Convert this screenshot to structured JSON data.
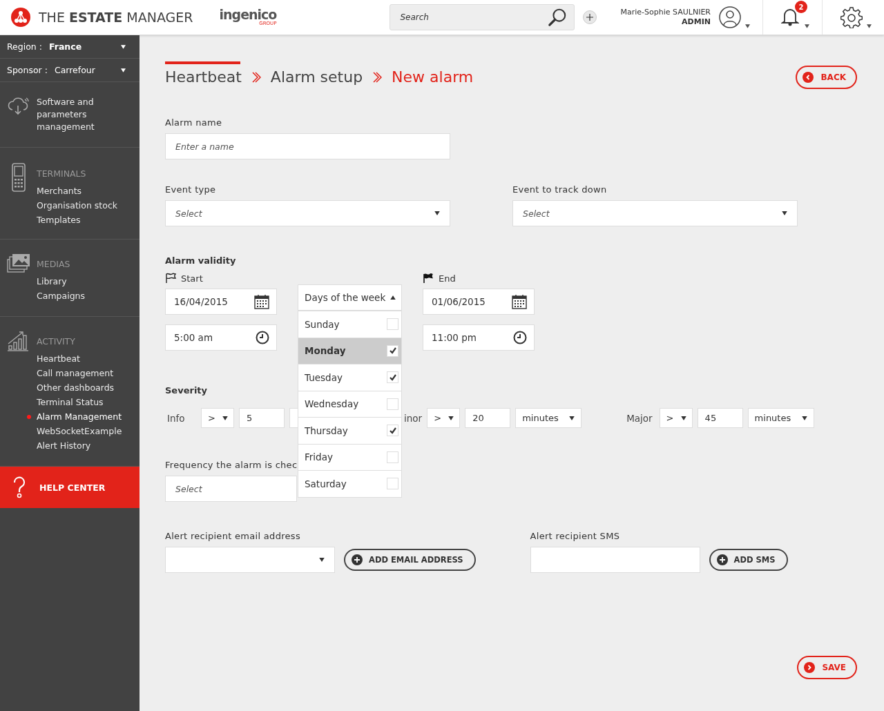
{
  "header": {
    "app_title": "THE **ESTATE** MANAGER",
    "brand": "ingenico",
    "brand_sub": "GROUP",
    "search": {
      "placeholder": "Search"
    },
    "user": {
      "name": "Marie-Sophie SAULNIER",
      "role": "ADMIN"
    },
    "notifications": "2"
  },
  "sidebar": {
    "filters": [
      {
        "label": "Region :",
        "value": "France",
        "bold": true
      },
      {
        "label": "Sponsor :",
        "value": "Carrefour",
        "bold": false
      }
    ],
    "sections": [
      {
        "kind": "cloud",
        "items": [
          {
            "label": "Software and parameters management",
            "active": false
          }
        ]
      },
      {
        "kind": "terminal",
        "heading": "TERMINALS",
        "items": [
          {
            "label": "Merchants",
            "active": false
          },
          {
            "label": "Organisation stock",
            "active": false
          },
          {
            "label": "Templates",
            "active": false
          }
        ]
      },
      {
        "kind": "media",
        "heading": "MEDIAS",
        "items": [
          {
            "label": "Library",
            "active": false
          },
          {
            "label": "Campaigns",
            "active": false
          }
        ]
      },
      {
        "kind": "activity",
        "heading": "ACTIVITY",
        "items": [
          {
            "label": "Heartbeat",
            "active": false
          },
          {
            "label": "Call management",
            "active": false
          },
          {
            "label": "Other dashboards",
            "active": false
          },
          {
            "label": "Terminal Status",
            "active": false
          },
          {
            "label": "Alarm Management",
            "active": true
          },
          {
            "label": "WebSocketExample",
            "active": false
          },
          {
            "label": "Alert History",
            "active": false
          }
        ]
      }
    ],
    "help": "HELP CENTER"
  },
  "breadcrumb": [
    {
      "label": "Heartbeat",
      "current": false
    },
    {
      "label": "Alarm setup",
      "current": false
    },
    {
      "label": "New alarm",
      "current": true
    }
  ],
  "back_button": "BACK",
  "alarm_name": {
    "label": "Alarm name",
    "placeholder": "Enter a name"
  },
  "event_type": {
    "label": "Event type",
    "placeholder": "Select"
  },
  "event_track": {
    "label": "Event to track down",
    "placeholder": "Select"
  },
  "validity": {
    "title": "Alarm validity",
    "start": {
      "label": "Start",
      "date": "16/04/2015",
      "time": "5:00 am"
    },
    "end": {
      "label": "End",
      "date": "01/06/2015",
      "time": "11:00 pm"
    },
    "days": {
      "label": "Days of the week",
      "expanded": true,
      "options": [
        {
          "label": "Sunday",
          "checked": false,
          "highlighted": false
        },
        {
          "label": "Monday",
          "checked": true,
          "highlighted": true
        },
        {
          "label": "Tuesday",
          "checked": true,
          "highlighted": false
        },
        {
          "label": "Wednesday",
          "checked": false,
          "highlighted": false
        },
        {
          "label": "Thursday",
          "checked": true,
          "highlighted": false
        },
        {
          "label": "Friday",
          "checked": false,
          "highlighted": false
        },
        {
          "label": "Saturday",
          "checked": false,
          "highlighted": false
        }
      ]
    }
  },
  "severity": {
    "title": "Severity",
    "levels": [
      {
        "label": "Info",
        "operator": ">",
        "value": "5"
      },
      {
        "label": "inor",
        "operator": ">",
        "value": "20",
        "unit": "minutes"
      },
      {
        "label": "Major",
        "operator": ">",
        "value": "45",
        "unit": "minutes"
      }
    ]
  },
  "frequency": {
    "label": "Frequency the alarm is chec",
    "placeholder": "Select"
  },
  "email": {
    "label": "Alert recipient email address",
    "button": "ADD EMAIL ADDRESS"
  },
  "sms": {
    "label": "Alert recipient SMS",
    "button": "ADD SMS"
  },
  "save_button": "SAVE"
}
